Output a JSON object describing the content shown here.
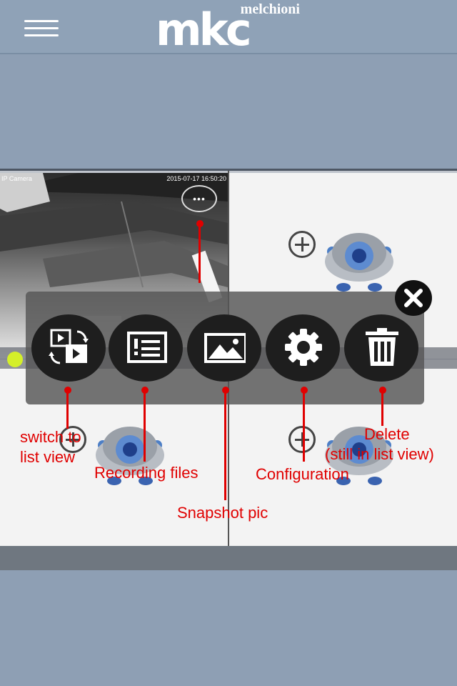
{
  "header": {
    "logo_sub": "melchioni",
    "logo_main": "mkc"
  },
  "camera": {
    "label": "IP Camera",
    "timestamp": "2015-07-17 16:50:20"
  },
  "toolbar": {
    "buttons": [
      "switch-view",
      "recording-files",
      "snapshot",
      "configuration",
      "delete"
    ]
  },
  "annotations": {
    "switch_line1": "switch to",
    "switch_line2": "list view",
    "recording": "Recording files",
    "snapshot": "Snapshot pic",
    "configuration": "Configuration",
    "delete_line1": "Delete",
    "delete_line2": "(still in list view)"
  },
  "colors": {
    "annotation": "#e00000",
    "status_online": "#d4ef2a",
    "header_bg": "#8fa2b7"
  }
}
